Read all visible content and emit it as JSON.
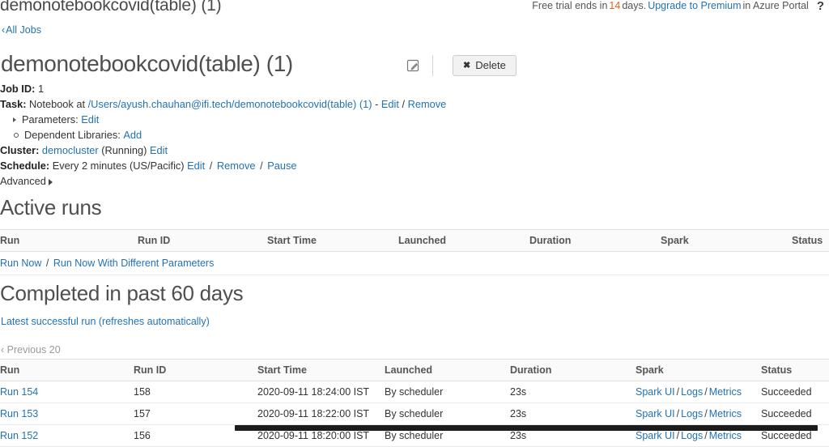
{
  "topbar": {
    "title": "demonotebookcovid(table) (1)",
    "trial_prefix": "Free trial ends in",
    "trial_days": "14",
    "trial_mid": "days.",
    "trial_link": "Upgrade to Premium",
    "trial_suffix": "in Azure Portal",
    "help_icon": "?"
  },
  "breadcrumb": {
    "chevron": "‹",
    "label": "All Jobs"
  },
  "job": {
    "title": "demonotebookcovid(table) (1)",
    "edit_icon": "edit-pencil-icon",
    "delete_label": "Delete",
    "delete_icon": "✖",
    "job_id_label": "Job ID:",
    "job_id_value": "1",
    "task_label": "Task:",
    "task_prefix": "Notebook at",
    "task_path": "/Users/ayush.chauhan@ifi.tech/demonotebookcovid(table) (1)",
    "task_dash": "-",
    "task_edit": "Edit",
    "task_slash": "/",
    "task_remove": "Remove",
    "parameters_label": "Parameters:",
    "parameters_link": "Edit",
    "dependent_libraries_label": "Dependent Libraries:",
    "dependent_libraries_link": "Add",
    "cluster_label": "Cluster:",
    "cluster_name": "democluster",
    "cluster_state": "(Running)",
    "cluster_edit": "Edit",
    "schedule_label": "Schedule:",
    "schedule_value": "Every 2 minutes (US/Pacific)",
    "schedule_edit": "Edit",
    "schedule_remove": "Remove",
    "schedule_pause": "Pause",
    "advanced_label": "Advanced"
  },
  "active_runs": {
    "title": "Active runs",
    "columns": [
      "Run",
      "Run ID",
      "Start Time",
      "Launched",
      "Duration",
      "Spark",
      "Status"
    ],
    "run_now": "Run Now",
    "run_now_separator": "/",
    "run_now_params": "Run Now With Different Parameters",
    "rows": []
  },
  "completed_runs": {
    "title": "Completed in past 60 days",
    "latest_link": "Latest successful run (refreshes automatically)",
    "previous_label": "‹ Previous 20",
    "columns": [
      "Run",
      "Run ID",
      "Start Time",
      "Launched",
      "Duration",
      "Spark",
      "Status"
    ],
    "spark_links": [
      "Spark UI",
      "Logs",
      "Metrics"
    ],
    "rows": [
      {
        "run": "Run 154",
        "run_id": "158",
        "start_time": "2020-09-11 18:24:00 IST",
        "launched": "By scheduler",
        "duration": "23s",
        "status": "Succeeded"
      },
      {
        "run": "Run 153",
        "run_id": "157",
        "start_time": "2020-09-11 18:22:00 IST",
        "launched": "By scheduler",
        "duration": "23s",
        "status": "Succeeded"
      },
      {
        "run": "Run 152",
        "run_id": "156",
        "start_time": "2020-09-11 18:20:00 IST",
        "launched": "By scheduler",
        "duration": "23s",
        "status": "Succeeded"
      }
    ]
  },
  "colors": {
    "link": "#2272b4",
    "trial_warning": "#e8601c",
    "heading": "#4f4f4f",
    "scrollbar": "#1c1c1c"
  }
}
